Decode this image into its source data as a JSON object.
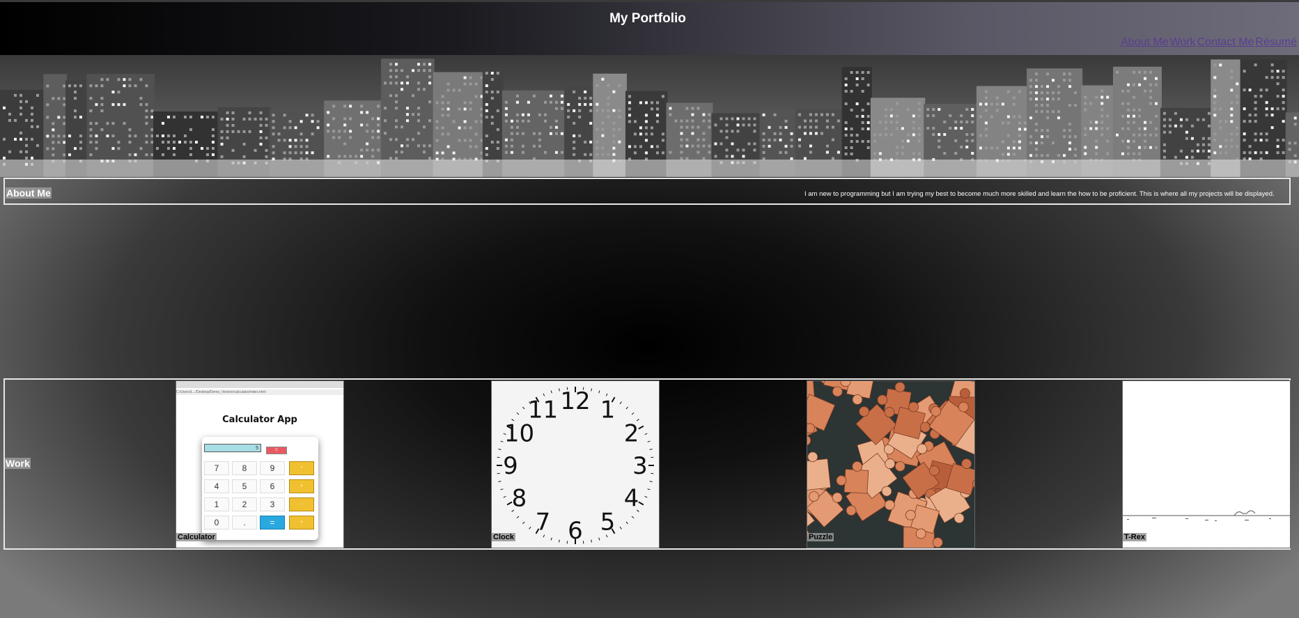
{
  "header": {
    "title": "My Portfolio",
    "nav": [
      "About Me",
      "Work",
      "Contact Me",
      "Résumé"
    ]
  },
  "about": {
    "label": "About Me",
    "text": "I am new to programming but I am trying my best to become much more skilled and learn the how to be proficient. This is where all my projects will be displayed."
  },
  "work": {
    "label": "Work",
    "projects": [
      {
        "label": "Calculator"
      },
      {
        "label": "Clock"
      },
      {
        "label": "Puzzle"
      },
      {
        "label": "T-Rex"
      }
    ]
  },
  "calculator_preview": {
    "address_bar": "C:/Users/L.../Desktop/Demo_Version/calculator/index.html",
    "title": "Calculator App",
    "display": "5",
    "keys": [
      "7",
      "8",
      "9",
      "4",
      "5",
      "6",
      "1",
      "2",
      "3",
      "0",
      ".",
      "="
    ]
  },
  "clock_preview": {
    "numerals": [
      "12",
      "1",
      "2",
      "3",
      "4",
      "5",
      "6",
      "7",
      "8",
      "9",
      "10",
      "11"
    ]
  },
  "colors": {
    "link": "#5b3d92",
    "border": "#e8e8e8",
    "calc_display": "#a8dde6",
    "calc_operator": "#f0c030",
    "calc_equals": "#2aa8e0",
    "calc_clear": "#e85a63"
  }
}
